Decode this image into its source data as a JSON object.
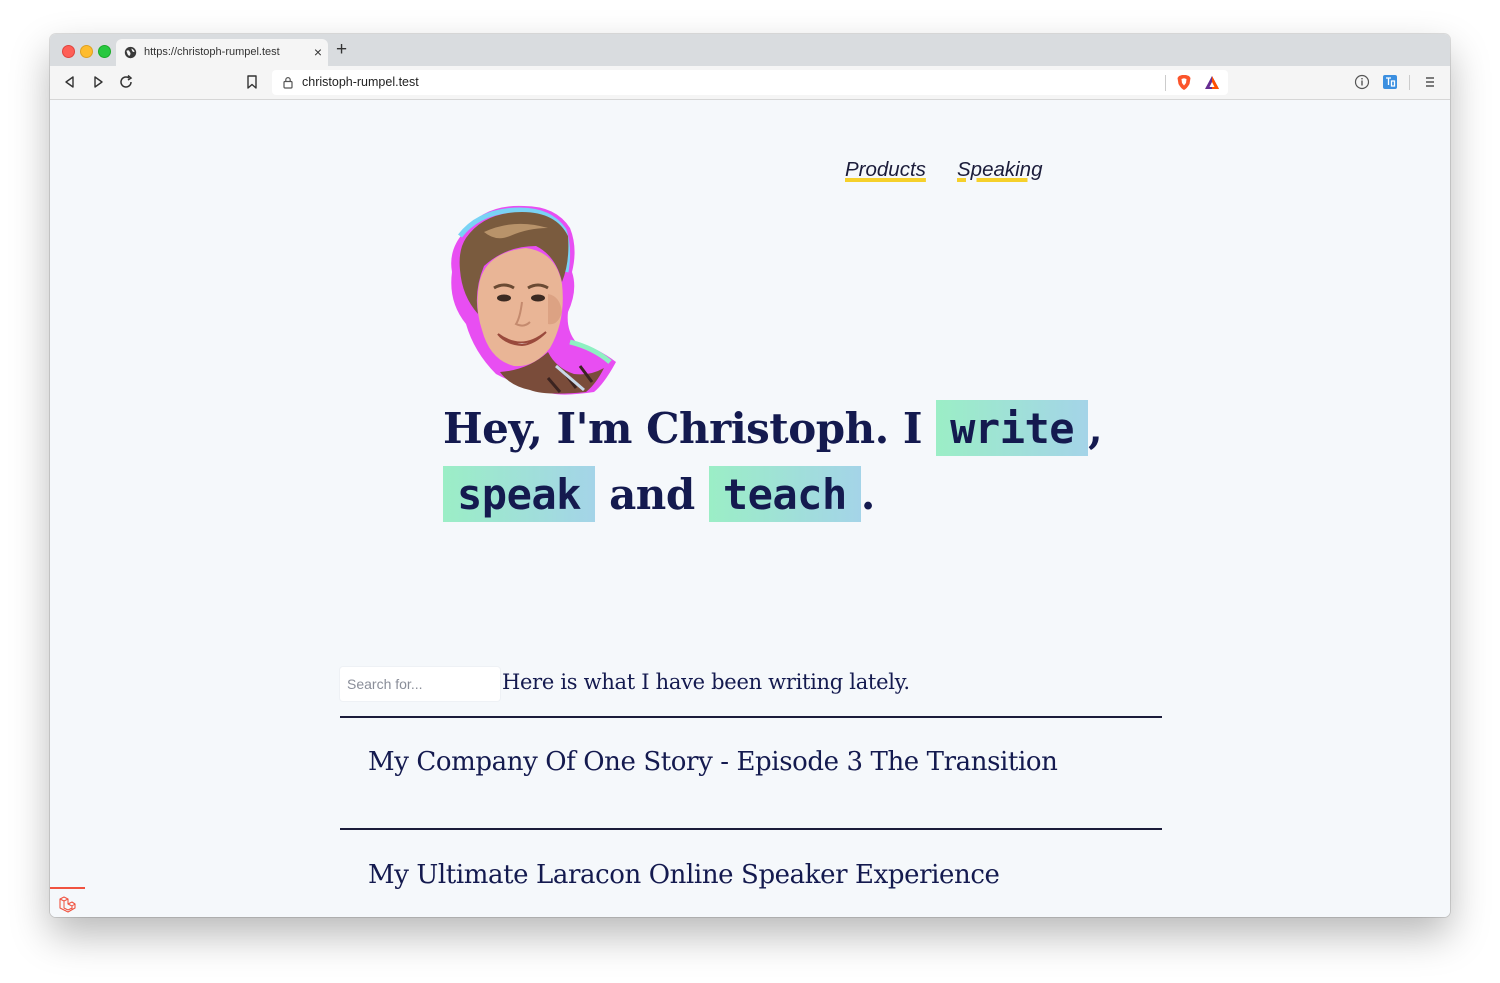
{
  "browser": {
    "tab_title": "https://christoph-rumpel.test",
    "new_tab_label": "+",
    "close_tab_label": "×",
    "url": "christoph-rumpel.test"
  },
  "nav": {
    "items": [
      {
        "label": "Products"
      },
      {
        "label": "Speaking"
      }
    ]
  },
  "hero": {
    "line1_prefix": "Hey, I'm Christoph. I",
    "word_write": "write",
    "line1_suffix": ",",
    "word_speak": "speak",
    "word_and": "and",
    "word_teach": "teach",
    "line2_suffix": "."
  },
  "search": {
    "placeholder": "Search for..."
  },
  "intro_text": "Here is what I have been writing lately.",
  "posts": [
    {
      "title": "My Company Of One Story - Episode 3 The Transition"
    },
    {
      "title": "My Ultimate Laracon Online Speaker Experience"
    }
  ],
  "colors": {
    "accent_underline": "#f5d02b",
    "highlight_start": "#9beec6",
    "highlight_end": "#a4d4e8",
    "text_dark": "#141a4f",
    "laravel_red": "#f05340"
  }
}
